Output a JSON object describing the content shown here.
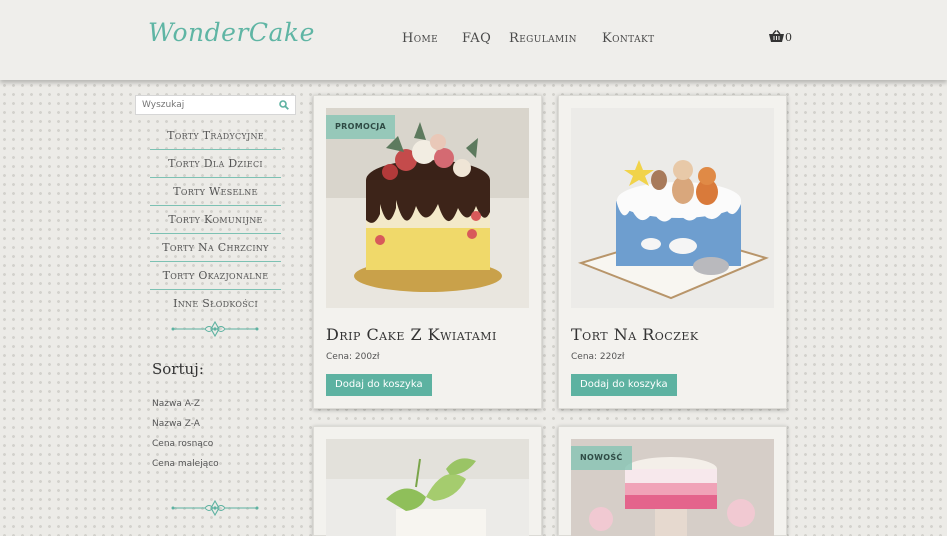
{
  "header": {
    "logo": "WonderCake",
    "nav": [
      "Home",
      "FAQ",
      "Regulamin",
      "Kontakt"
    ],
    "cart_count": "0"
  },
  "sidebar": {
    "search_placeholder": "Wyszukaj",
    "categories": [
      "Torty Tradycyjne",
      "Torty Dla Dzieci",
      "Torty Weselne",
      "Torty Komunijne",
      "Torty Na Chrzciny",
      "Torty Okazjonalne",
      "Inne Słodkości"
    ],
    "sort_title": "Sortuj:",
    "sort_options": [
      "Nazwa A-Z",
      "Nazwa Z-A",
      "Cena rosnąco",
      "Cena malejąco"
    ]
  },
  "products": [
    {
      "title": "Drip Cake Z Kwiatami",
      "price": "Cena: 200zł",
      "badge": "PROMOCJA",
      "button": "Dodaj do koszyka"
    },
    {
      "title": "Tort Na Roczek",
      "price": "Cena: 220zł",
      "badge": "",
      "button": "Dodaj do koszyka"
    },
    {
      "title": "",
      "price": "",
      "badge": "",
      "button": ""
    },
    {
      "title": "",
      "price": "",
      "badge": "NOWOŚĆ",
      "button": ""
    }
  ],
  "colors": {
    "accent": "#5db2a1",
    "background": "#ecebe7",
    "header": "#efeeeb"
  }
}
